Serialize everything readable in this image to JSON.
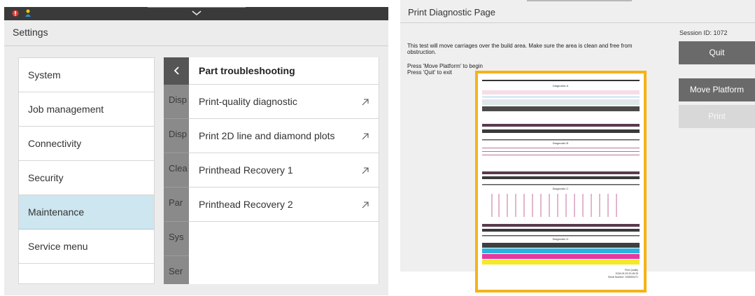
{
  "left_panel": {
    "header_title": "Settings",
    "menu": {
      "items": [
        {
          "label": "System",
          "active": false
        },
        {
          "label": "Job management",
          "active": false
        },
        {
          "label": "Connectivity",
          "active": false
        },
        {
          "label": "Security",
          "active": false
        },
        {
          "label": "Maintenance",
          "active": true
        },
        {
          "label": "Service menu",
          "active": false
        }
      ]
    },
    "underlying_list": {
      "back_icon": "chevron-left-icon",
      "items": [
        "Disp",
        "Disp",
        "Clea",
        "Par",
        "Sys",
        "Ser"
      ]
    },
    "drawer": {
      "title": "Part troubleshooting",
      "items": [
        {
          "label": "Print-quality diagnostic",
          "icon": "arrow-up-right-icon"
        },
        {
          "label": "Print 2D line and diamond plots",
          "icon": "arrow-up-right-icon"
        },
        {
          "label": "Printhead Recovery 1",
          "icon": "arrow-up-right-icon"
        },
        {
          "label": "Printhead Recovery 2",
          "icon": "arrow-up-right-icon"
        }
      ]
    }
  },
  "right_panel": {
    "title": "Print Diagnostic Page",
    "session_id": "Session ID: 1072",
    "description": "This test will move carriages over the build area. Make sure the area is clean and free from obstruction.",
    "instructions": [
      "Press 'Move Platform' to begin",
      "Press 'Quit' to exit"
    ],
    "buttons": {
      "quit": "Quit",
      "move_platform": "Move Platform",
      "print": "Print"
    },
    "preview": {
      "highlight_color": "#f5b21a",
      "sections": [
        "Diagnostic A",
        "Diagnostic B",
        "Diagnostic C",
        "Diagnostic D"
      ],
      "footer_lines": [
        "Print Quality",
        "2018-09-25 20:45:25",
        "Serial Number: SG8900471"
      ]
    }
  }
}
